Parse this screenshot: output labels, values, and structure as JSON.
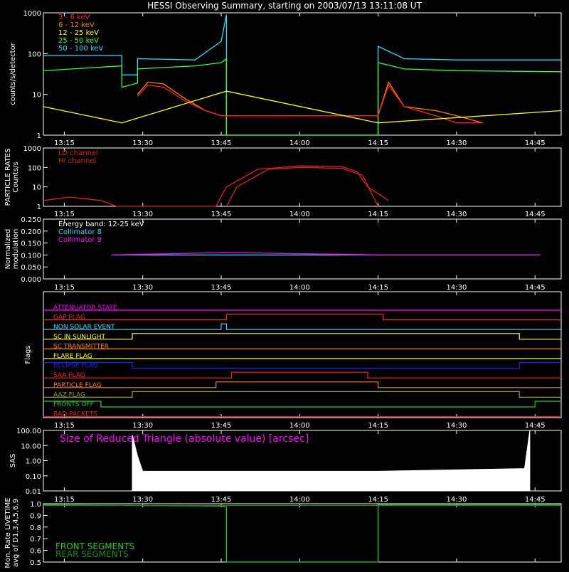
{
  "title": "HESSI Observing Summary, starting on 2003/07/13 13:11:08 UT",
  "colors": {
    "bg": "#000000",
    "axis": "#ffffff",
    "lo_3_6": "#ff2020",
    "lo_6_12": "#ff8000",
    "lo_12_25": "#ffff00",
    "lo_25_50": "#30ff30",
    "lo_50_100": "#20e0ff",
    "red": "#dd2020",
    "magenta": "#ff00ff",
    "cyan": "#20e0ff",
    "green": "#20cc20",
    "blue": "#2020ff",
    "orange": "#ff8000",
    "olive": "#90a020",
    "yellow": "#ffff00"
  },
  "time_ticks": [
    "13:15",
    "13:30",
    "13:45",
    "14:00",
    "14:15",
    "14:30",
    "14:45"
  ],
  "chart_data": [
    {
      "id": "lightcurve",
      "type": "line",
      "ylabel": "counts/s/detector",
      "yscale": "log",
      "ylim": [
        1,
        1000
      ],
      "y_ticks": [
        "1",
        "10",
        "100",
        "1000"
      ],
      "legend": [
        "3 - 6 keV",
        "6 - 12 keV",
        "12 - 25 keV",
        "25 - 50 keV",
        "50 - 100 keV"
      ],
      "series": [
        {
          "name": "50 - 100 keV",
          "x": [
            "13:11",
            "13:26",
            "13:26",
            "13:29",
            "13:29",
            "13:40",
            "13:45",
            "13:46",
            "13:46",
            "14:15",
            "14:15",
            "14:20",
            "14:30",
            "14:50"
          ],
          "values": [
            90,
            90,
            30,
            30,
            75,
            70,
            200,
            900,
            1,
            1,
            150,
            75,
            70,
            70
          ]
        },
        {
          "name": "25 - 50 keV",
          "x": [
            "13:11",
            "13:26",
            "13:26",
            "13:29",
            "13:29",
            "13:40",
            "13:45",
            "13:46",
            "13:46",
            "14:15",
            "14:15",
            "14:20",
            "14:30",
            "14:50"
          ],
          "values": [
            38,
            50,
            15,
            19,
            42,
            50,
            60,
            75,
            1,
            1,
            60,
            42,
            38,
            36
          ]
        },
        {
          "name": "6 - 12 keV",
          "x": [
            "13:29",
            "13:31",
            "13:34",
            "13:38",
            "13:42",
            "13:45",
            "14:15",
            "14:17",
            "14:20",
            "14:26",
            "14:30",
            "14:35"
          ],
          "values": [
            10,
            20,
            18,
            8,
            4,
            3,
            3,
            20,
            5,
            4,
            3,
            2
          ]
        },
        {
          "name": "3 - 6 keV",
          "x": [
            "13:29",
            "13:31",
            "13:34",
            "13:38",
            "13:42",
            "13:45",
            "14:15",
            "14:17",
            "14:20",
            "14:26",
            "14:30",
            "14:35"
          ],
          "values": [
            9,
            17,
            15,
            7,
            4,
            3,
            3,
            17,
            5,
            3,
            2,
            2
          ]
        },
        {
          "name": "12 - 25 keV",
          "x": [
            "13:11",
            "13:26",
            "13:46",
            "14:15",
            "14:50"
          ],
          "values": [
            5,
            2,
            12,
            2,
            4
          ]
        }
      ]
    },
    {
      "id": "particle",
      "type": "line",
      "ylabel": "PARTICLE RATES",
      "ylabel2": "Counts/s",
      "yscale": "log",
      "ylim": [
        1,
        1000
      ],
      "y_ticks": [
        "1",
        "10",
        "100",
        "1000"
      ],
      "legend": [
        "LO channel",
        "HI channel"
      ],
      "series": [
        {
          "name": "LO channel",
          "x": [
            "13:11",
            "13:16",
            "13:22",
            "13:25",
            "13:44",
            "13:46",
            "13:52",
            "14:00",
            "14:08",
            "14:11",
            "14:13",
            "14:17"
          ],
          "values": [
            2,
            3,
            2,
            1,
            1,
            10,
            80,
            120,
            110,
            60,
            10,
            2
          ]
        },
        {
          "name": "HI channel",
          "x": [
            "13:46",
            "13:48",
            "13:54",
            "14:00",
            "14:08",
            "14:12",
            "14:15"
          ],
          "values": [
            1,
            10,
            80,
            100,
            90,
            40,
            1
          ]
        }
      ]
    },
    {
      "id": "modulation",
      "type": "line",
      "ylabel": "Normalized",
      "ylabel2": "modulation",
      "ylim": [
        0,
        0.25
      ],
      "y_ticks": [
        "0.000",
        "0.050",
        "0.100",
        "0.150",
        "0.200",
        "0.250"
      ],
      "legend": [
        "Energy band: 12-25 keV",
        "Collimator 8",
        "Collimator 9"
      ],
      "series": [
        {
          "name": "Collimator 8",
          "x": [
            "13:24",
            "13:46",
            "14:16",
            "14:46"
          ],
          "values": [
            0.1,
            0.1,
            0.1,
            0.1
          ]
        },
        {
          "name": "Collimator 9",
          "x": [
            "13:24",
            "13:46",
            "14:16",
            "14:46"
          ],
          "values": [
            0.1,
            0.11,
            0.1,
            0.1
          ]
        }
      ]
    },
    {
      "id": "flags",
      "type": "line",
      "ylabel": "Flags",
      "flags": [
        {
          "name": "ATTENUATOR STATE",
          "color": "#ff00ff",
          "x": [
            "13:11",
            "14:50"
          ],
          "values": [
            0,
            0
          ]
        },
        {
          "name": "GAP FLAG",
          "color": "#ff2020",
          "x": [
            "13:11",
            "13:46",
            "13:46",
            "14:16",
            "14:16",
            "14:50"
          ],
          "values": [
            0,
            0,
            1,
            1,
            0,
            0
          ]
        },
        {
          "name": "NON SOLAR EVENT",
          "color": "#20e0ff",
          "x": [
            "13:11",
            "13:45",
            "13:45",
            "13:46",
            "13:46",
            "14:50"
          ],
          "values": [
            0,
            0,
            1,
            1,
            0,
            0
          ]
        },
        {
          "name": "SC IN SUNLIGHT",
          "color": "#ffff00",
          "x": [
            "13:11",
            "13:28",
            "13:28",
            "14:42",
            "14:42",
            "14:50"
          ],
          "values": [
            0,
            0,
            1,
            1,
            0,
            0
          ]
        },
        {
          "name": "SC TRANSMITTER",
          "color": "#ff8000",
          "x": [
            "13:11",
            "14:50"
          ],
          "values": [
            0,
            0
          ]
        },
        {
          "name": "FLARE FLAG",
          "color": "#ffff00",
          "x": [
            "13:11",
            "14:50"
          ],
          "values": [
            0,
            0
          ]
        },
        {
          "name": "ECLIPSE FLAG",
          "color": "#2020ff",
          "x": [
            "13:11",
            "13:28",
            "13:28",
            "14:42",
            "14:42",
            "14:50"
          ],
          "values": [
            1,
            1,
            0,
            0,
            1,
            1
          ]
        },
        {
          "name": "SAA FLAG",
          "color": "#ff2020",
          "x": [
            "13:11",
            "13:47",
            "13:47",
            "14:13",
            "14:13",
            "14:50"
          ],
          "values": [
            0,
            0,
            1,
            1,
            0,
            0
          ]
        },
        {
          "name": "PARTICLE FLAG",
          "color": "#ff8000",
          "x": [
            "13:11",
            "13:44",
            "13:44",
            "14:15",
            "14:15",
            "14:50"
          ],
          "values": [
            0,
            0,
            1,
            1,
            0,
            0
          ]
        },
        {
          "name": "AAZ FLAG",
          "color": "#90a020",
          "x": [
            "13:11",
            "13:28",
            "13:28",
            "14:42",
            "14:42",
            "14:50"
          ],
          "values": [
            0,
            0,
            1,
            1,
            0,
            0
          ]
        },
        {
          "name": "FRONTS OFF",
          "color": "#20cc20",
          "x": [
            "13:11",
            "13:22",
            "13:22",
            "14:45",
            "14:45",
            "14:50"
          ],
          "values": [
            1,
            1,
            0,
            0,
            1,
            1
          ]
        },
        {
          "name": "BAD PACKETS",
          "color": "#dd2020",
          "x": [
            "13:11",
            "14:50"
          ],
          "values": [
            0,
            0
          ]
        }
      ]
    },
    {
      "id": "sas",
      "type": "area",
      "ylabel": "SAS",
      "yscale": "log",
      "ylim": [
        0.01,
        100
      ],
      "y_ticks": [
        "0.01",
        "0.10",
        "1.00",
        "10.00",
        "100.00"
      ],
      "legend": [
        "Size of Reduced Triangle (absolute value) [arcsec]"
      ],
      "series": [
        {
          "name": "Size of Reduced Triangle (absolute value) [arcsec]",
          "x": [
            "13:28",
            "13:29",
            "13:30",
            "13:45",
            "14:15",
            "14:43",
            "14:44"
          ],
          "values": [
            50,
            2,
            0.2,
            0.2,
            0.2,
            0.3,
            100
          ]
        }
      ]
    },
    {
      "id": "livetime",
      "type": "line",
      "ylabel": "Mon. Rate LIVETIME",
      "ylabel2": "avg of D1,3,4,5,6,9",
      "ylim": [
        0.5,
        1.0
      ],
      "y_ticks": [
        "0.5",
        "0.6",
        "0.7",
        "0.8",
        "0.9",
        "1.0"
      ],
      "legend": [
        "FRONT SEGMENTS",
        "REAR SEGMENTS"
      ],
      "series": [
        {
          "name": "FRONT SEGMENTS",
          "x": [
            "13:11",
            "13:45",
            "13:46",
            "13:46",
            "14:15",
            "14:15",
            "14:50"
          ],
          "values": [
            0.99,
            0.98,
            0.97,
            0.5,
            0.5,
            0.99,
            0.99
          ]
        },
        {
          "name": "REAR SEGMENTS",
          "x": [
            "13:11",
            "13:46",
            "14:15",
            "14:50"
          ],
          "values": [
            0.985,
            0.985,
            0.985,
            0.985
          ]
        }
      ]
    }
  ]
}
